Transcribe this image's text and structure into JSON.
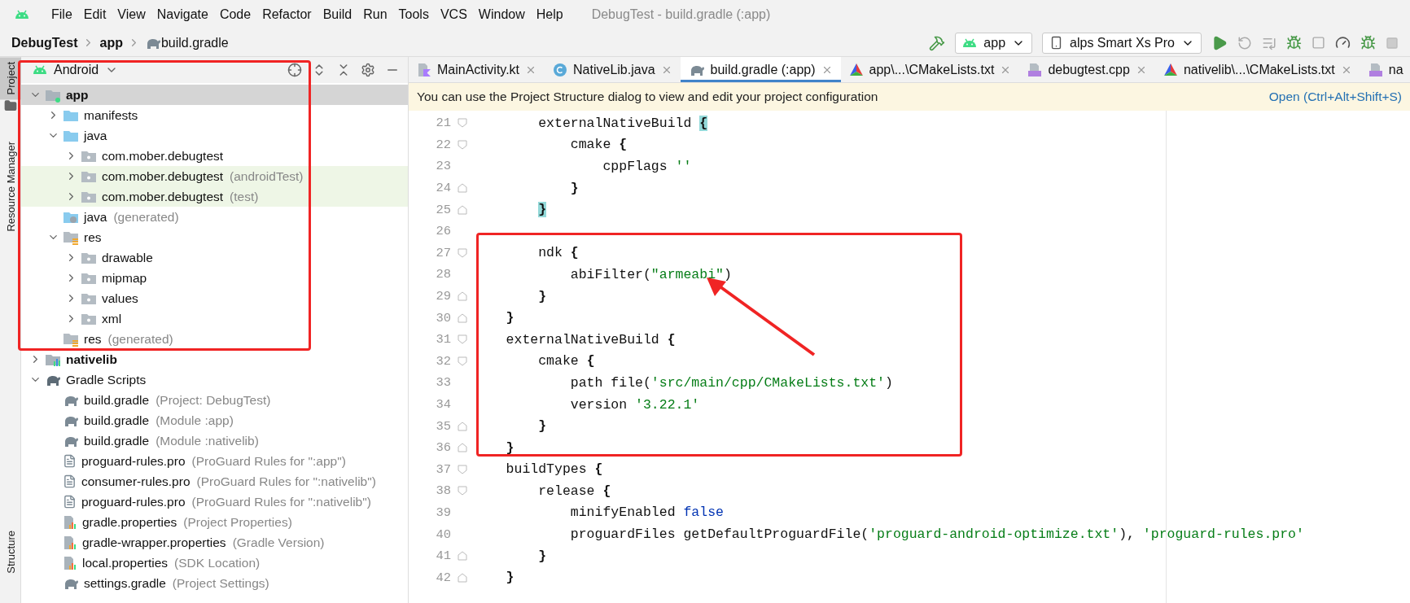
{
  "menu_bar": {
    "items": [
      "File",
      "Edit",
      "View",
      "Navigate",
      "Code",
      "Refactor",
      "Build",
      "Run",
      "Tools",
      "VCS",
      "Window",
      "Help"
    ],
    "title": "DebugTest - build.gradle (:app)"
  },
  "breadcrumb": [
    {
      "label": "DebugTest",
      "kind": "project"
    },
    {
      "label": "app",
      "kind": "module"
    },
    {
      "label": "build.gradle",
      "kind": "gradle"
    }
  ],
  "toolbar": {
    "configuration": "app",
    "device": "alps Smart Xs Pro"
  },
  "side_tabs": [
    {
      "label": "Project",
      "selected": true
    },
    {
      "label": "Resource Manager",
      "selected": false
    },
    {
      "label": "Structure",
      "selected": false
    }
  ],
  "project_panel": {
    "view": "Android",
    "tree": [
      {
        "name": "app",
        "kind": "module",
        "expanded": true,
        "selected": true,
        "children": [
          {
            "name": "manifests",
            "kind": "source-folder",
            "expanded": false,
            "selected": false
          },
          {
            "name": "java",
            "kind": "source-folder",
            "expanded": true,
            "selected": false,
            "children": [
              {
                "name": "com.mober.debugtest",
                "kind": "package",
                "expanded": false,
                "selected": false
              },
              {
                "name": "com.mober.debugtest",
                "note": "(androidTest)",
                "kind": "package",
                "test": true,
                "expanded": false,
                "selected": false
              },
              {
                "name": "com.mober.debugtest",
                "note": "(test)",
                "kind": "package",
                "test": true,
                "expanded": false,
                "selected": false
              }
            ]
          },
          {
            "name": "java",
            "note": "(generated)",
            "kind": "generated",
            "selected": false
          },
          {
            "name": "res",
            "kind": "res",
            "expanded": true,
            "selected": false,
            "children": [
              {
                "name": "drawable",
                "kind": "package",
                "expanded": false,
                "selected": false
              },
              {
                "name": "mipmap",
                "kind": "package",
                "expanded": false,
                "selected": false
              },
              {
                "name": "values",
                "kind": "package",
                "expanded": false,
                "selected": false
              },
              {
                "name": "xml",
                "kind": "package",
                "expanded": false,
                "selected": false
              }
            ]
          },
          {
            "name": "res",
            "note": "(generated)",
            "kind": "res",
            "selected": false
          }
        ]
      },
      {
        "name": "nativelib",
        "kind": "library",
        "expanded": false,
        "selected": false
      },
      {
        "name": "Gradle Scripts",
        "kind": "gradle-group",
        "expanded": true,
        "selected": false,
        "children": [
          {
            "name": "build.gradle",
            "note": "(Project: DebugTest)",
            "kind": "gradle",
            "selected": false
          },
          {
            "name": "build.gradle",
            "note": "(Module :app)",
            "kind": "gradle",
            "selected": false
          },
          {
            "name": "build.gradle",
            "note": "(Module :nativelib)",
            "kind": "gradle",
            "selected": false
          },
          {
            "name": "proguard-rules.pro",
            "note": "(ProGuard Rules for \":app\")",
            "kind": "text",
            "selected": false
          },
          {
            "name": "consumer-rules.pro",
            "note": "(ProGuard Rules for \":nativelib\")",
            "kind": "text",
            "selected": false
          },
          {
            "name": "proguard-rules.pro",
            "note": "(ProGuard Rules for \":nativelib\")",
            "kind": "text",
            "selected": false
          },
          {
            "name": "gradle.properties",
            "note": "(Project Properties)",
            "kind": "properties",
            "selected": false
          },
          {
            "name": "gradle-wrapper.properties",
            "note": "(Gradle Version)",
            "kind": "properties",
            "selected": false
          },
          {
            "name": "local.properties",
            "note": "(SDK Location)",
            "kind": "properties",
            "selected": false
          },
          {
            "name": "settings.gradle",
            "note": "(Project Settings)",
            "kind": "gradle",
            "selected": false
          }
        ]
      }
    ]
  },
  "editor": {
    "tabs": [
      {
        "label": "MainActivity.kt",
        "kind": "kotlin",
        "selected": false
      },
      {
        "label": "NativeLib.java",
        "kind": "java",
        "selected": false
      },
      {
        "label": "build.gradle (:app)",
        "kind": "gradle",
        "selected": true
      },
      {
        "label": "app\\...\\CMakeLists.txt",
        "kind": "cmake",
        "selected": false
      },
      {
        "label": "debugtest.cpp",
        "kind": "cpp",
        "selected": false
      },
      {
        "label": "nativelib\\...\\CMakeLists.txt",
        "kind": "cmake",
        "selected": false
      },
      {
        "label": "na",
        "kind": "cpp",
        "selected": false
      }
    ],
    "banner": {
      "text": "You can use the Project Structure dialog to view and edit your project configuration",
      "action": "Open (Ctrl+Alt+Shift+S)"
    },
    "lines": [
      {
        "number": "21",
        "fold_start": true,
        "tokens": [
          {
            "kind": "plain",
            "text": "        externalNativeBuild "
          },
          {
            "kind": "matched",
            "text": "{"
          }
        ]
      },
      {
        "number": "22",
        "fold_start": true,
        "tokens": [
          {
            "kind": "plain",
            "text": "            cmake "
          },
          {
            "kind": "brace",
            "text": "{"
          }
        ]
      },
      {
        "number": "23",
        "tokens": [
          {
            "kind": "plain",
            "text": "                cppFlags "
          },
          {
            "kind": "string",
            "text": "''"
          }
        ]
      },
      {
        "number": "24",
        "fold_end": true,
        "tokens": [
          {
            "kind": "brace",
            "text": "            }"
          }
        ]
      },
      {
        "number": "25",
        "fold_end": true,
        "tokens": [
          {
            "kind": "matched",
            "text": "        }"
          }
        ]
      },
      {
        "number": "26"
      },
      {
        "number": "27",
        "fold_start": true,
        "tokens": [
          {
            "kind": "plain",
            "text": "        ndk "
          },
          {
            "kind": "brace",
            "text": "{"
          }
        ]
      },
      {
        "number": "28",
        "tokens": [
          {
            "kind": "plain",
            "text": "            abiFilter("
          },
          {
            "kind": "string",
            "text": "\"armeabi\""
          },
          {
            "kind": "plain",
            "text": ")"
          }
        ]
      },
      {
        "number": "29",
        "fold_end": true,
        "tokens": [
          {
            "kind": "brace",
            "text": "        }"
          }
        ]
      },
      {
        "number": "30",
        "fold_end": true,
        "tokens": [
          {
            "kind": "brace",
            "text": "    }"
          }
        ]
      },
      {
        "number": "31",
        "fold_start": true,
        "tokens": [
          {
            "kind": "plain",
            "text": "    externalNativeBuild "
          },
          {
            "kind": "brace",
            "text": "{"
          }
        ]
      },
      {
        "number": "32",
        "fold_start": true,
        "tokens": [
          {
            "kind": "plain",
            "text": "        cmake "
          },
          {
            "kind": "brace",
            "text": "{"
          }
        ]
      },
      {
        "number": "33",
        "tokens": [
          {
            "kind": "plain",
            "text": "            path file("
          },
          {
            "kind": "string",
            "text": "'src/main/cpp/CMakeLists.txt'"
          },
          {
            "kind": "plain",
            "text": ")"
          }
        ]
      },
      {
        "number": "34",
        "tokens": [
          {
            "kind": "plain",
            "text": "            version "
          },
          {
            "kind": "string",
            "text": "'3.22.1'"
          }
        ]
      },
      {
        "number": "35",
        "fold_end": true,
        "tokens": [
          {
            "kind": "brace",
            "text": "        }"
          }
        ]
      },
      {
        "number": "36",
        "fold_end": true,
        "tokens": [
          {
            "kind": "brace",
            "text": "    }"
          }
        ]
      },
      {
        "number": "37",
        "fold_start": true,
        "tokens": [
          {
            "kind": "plain",
            "text": "    buildTypes "
          },
          {
            "kind": "brace",
            "text": "{"
          }
        ]
      },
      {
        "number": "38",
        "fold_start": true,
        "tokens": [
          {
            "kind": "plain",
            "text": "        release "
          },
          {
            "kind": "brace",
            "text": "{"
          }
        ]
      },
      {
        "number": "39",
        "tokens": [
          {
            "kind": "plain",
            "text": "            minifyEnabled "
          },
          {
            "kind": "keyword",
            "text": "false"
          }
        ]
      },
      {
        "number": "40",
        "tokens": [
          {
            "kind": "plain",
            "text": "            proguardFiles getDefaultProguardFile("
          },
          {
            "kind": "string",
            "text": "'proguard-android-optimize.txt'"
          },
          {
            "kind": "plain",
            "text": "), "
          },
          {
            "kind": "string",
            "text": "'proguard-rules.pro'"
          }
        ]
      },
      {
        "number": "41",
        "fold_end": true,
        "tokens": [
          {
            "kind": "brace",
            "text": "        }"
          }
        ]
      },
      {
        "number": "42",
        "fold_end": true,
        "tokens": [
          {
            "kind": "brace",
            "text": "    }"
          }
        ]
      }
    ]
  },
  "annotations": [
    {
      "kind": "box"
    },
    {
      "kind": "box"
    },
    {
      "kind": "arrow"
    }
  ]
}
